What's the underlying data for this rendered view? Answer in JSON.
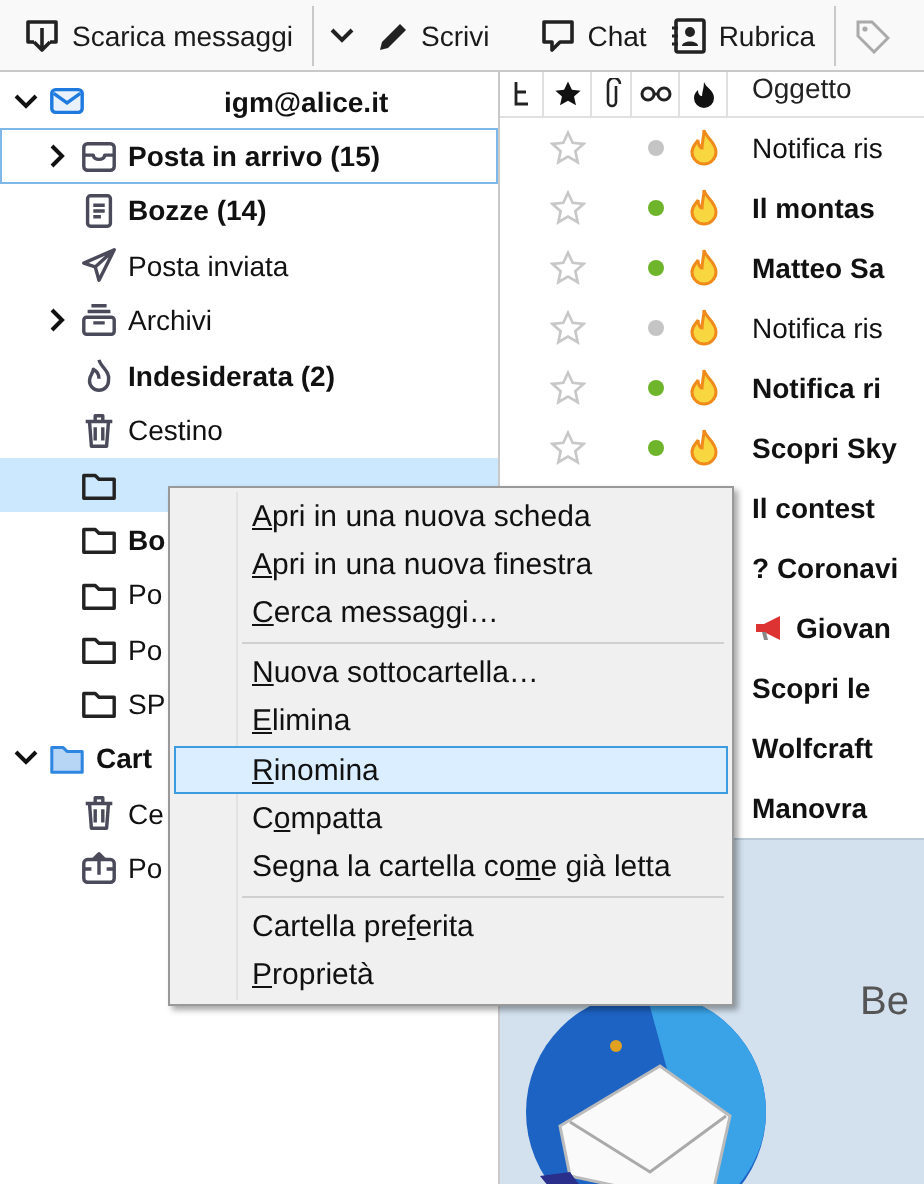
{
  "toolbar": {
    "buttons": [
      {
        "kind": "download",
        "label": "Scarica messaggi"
      },
      {
        "kind": "dropdown"
      },
      {
        "kind": "write",
        "label": "Scrivi"
      },
      {
        "kind": "chat",
        "label": "Chat"
      },
      {
        "kind": "addressbook",
        "label": "Rubrica"
      },
      {
        "kind": "tag"
      }
    ]
  },
  "folders": [
    {
      "kind": "account",
      "label": "igm@alice.it",
      "expanded": true,
      "selected": false,
      "focused": false,
      "has_unread": true,
      "children": [
        {
          "kind": "inbox",
          "label": "Posta in arrivo (15)",
          "expanded": false,
          "selected": false,
          "focused": true,
          "has_unread": true
        },
        {
          "kind": "drafts",
          "label": "Bozze (14)",
          "selected": false,
          "focused": false,
          "has_unread": true
        },
        {
          "kind": "sent",
          "label": "Posta inviata",
          "selected": false,
          "focused": false,
          "has_unread": false
        },
        {
          "kind": "archive",
          "label": "Archivi",
          "expanded": false,
          "selected": false,
          "focused": false,
          "has_unread": false
        },
        {
          "kind": "junk",
          "label": "Indesiderata (2)",
          "selected": false,
          "focused": false,
          "has_unread": true
        },
        {
          "kind": "trash",
          "label": "Cestino",
          "selected": false,
          "focused": false,
          "has_unread": false
        },
        {
          "kind": "folder",
          "selected": true,
          "focused": false
        },
        {
          "kind": "folder",
          "label": "Bo",
          "selected": false,
          "focused": false,
          "has_unread": true
        },
        {
          "kind": "folder",
          "label": "Po",
          "selected": false,
          "focused": false,
          "has_unread": false
        },
        {
          "kind": "folder",
          "label": "Po",
          "selected": false,
          "focused": false,
          "has_unread": false
        },
        {
          "kind": "folder",
          "label": "SP",
          "selected": false,
          "focused": false,
          "has_unread": false
        }
      ]
    },
    {
      "kind": "local",
      "label": "Cart",
      "expanded": true,
      "selected": false,
      "focused": false,
      "has_unread": true,
      "children": [
        {
          "kind": "trash",
          "label": "Ce",
          "selected": false,
          "focused": false,
          "has_unread": false
        },
        {
          "kind": "outbox",
          "label": "Po",
          "selected": false,
          "focused": false,
          "has_unread": false
        }
      ]
    }
  ],
  "messages": {
    "columns": [
      {
        "kind": "thread"
      },
      {
        "kind": "star"
      },
      {
        "kind": "attachment"
      },
      {
        "kind": "read"
      },
      {
        "kind": "junk"
      },
      {
        "kind": "subject",
        "label": "Oggetto"
      }
    ],
    "rows": [
      {
        "subject": "Notifica ris",
        "unread": false,
        "starred": false
      },
      {
        "subject": "Il montas",
        "unread": true,
        "starred": false
      },
      {
        "subject": "Matteo Sa",
        "unread": true,
        "starred": false
      },
      {
        "subject": "Notifica ris",
        "unread": false,
        "starred": false
      },
      {
        "subject": "Notifica ri",
        "unread": true,
        "starred": false
      },
      {
        "subject": "Scopri Sky",
        "unread": true,
        "starred": false
      },
      {
        "subject": "Il contest",
        "unread": true
      },
      {
        "subject": "? Coronavi",
        "unread": true
      },
      {
        "subject": "Giovan",
        "unread": true,
        "kind": "megaphone"
      },
      {
        "subject": "Scopri le",
        "unread": true
      },
      {
        "subject": "Wolfcraft",
        "unread": true
      },
      {
        "subject": "Manovra",
        "unread": true
      }
    ]
  },
  "preview": {
    "line_1": "Be"
  },
  "context_menu": [
    {
      "kind": "item",
      "key": "A",
      "after": "pri in una nuova scheda",
      "selected": false
    },
    {
      "kind": "item",
      "key": "A",
      "after": "pri in una nuova finestra",
      "selected": false
    },
    {
      "kind": "item",
      "key": "C",
      "after": "erca messaggi…",
      "selected": false
    },
    {
      "kind": "separator"
    },
    {
      "kind": "item",
      "key": "N",
      "after": "uova sottocartella…",
      "selected": false
    },
    {
      "kind": "item",
      "key": "E",
      "after": "limina",
      "selected": false
    },
    {
      "kind": "item",
      "key": "R",
      "after": "inomina",
      "selected": true
    },
    {
      "kind": "item",
      "before": "C",
      "key": "o",
      "after": "mpatta",
      "selected": false
    },
    {
      "kind": "item",
      "before": "Segna la cartella co",
      "key": "m",
      "after": "e già letta",
      "selected": false
    },
    {
      "kind": "separator"
    },
    {
      "kind": "item",
      "before": "Cartella pre",
      "key": "f",
      "after": "erita",
      "selected": false
    },
    {
      "kind": "item",
      "key": "P",
      "after": "roprietà",
      "selected": false
    }
  ]
}
